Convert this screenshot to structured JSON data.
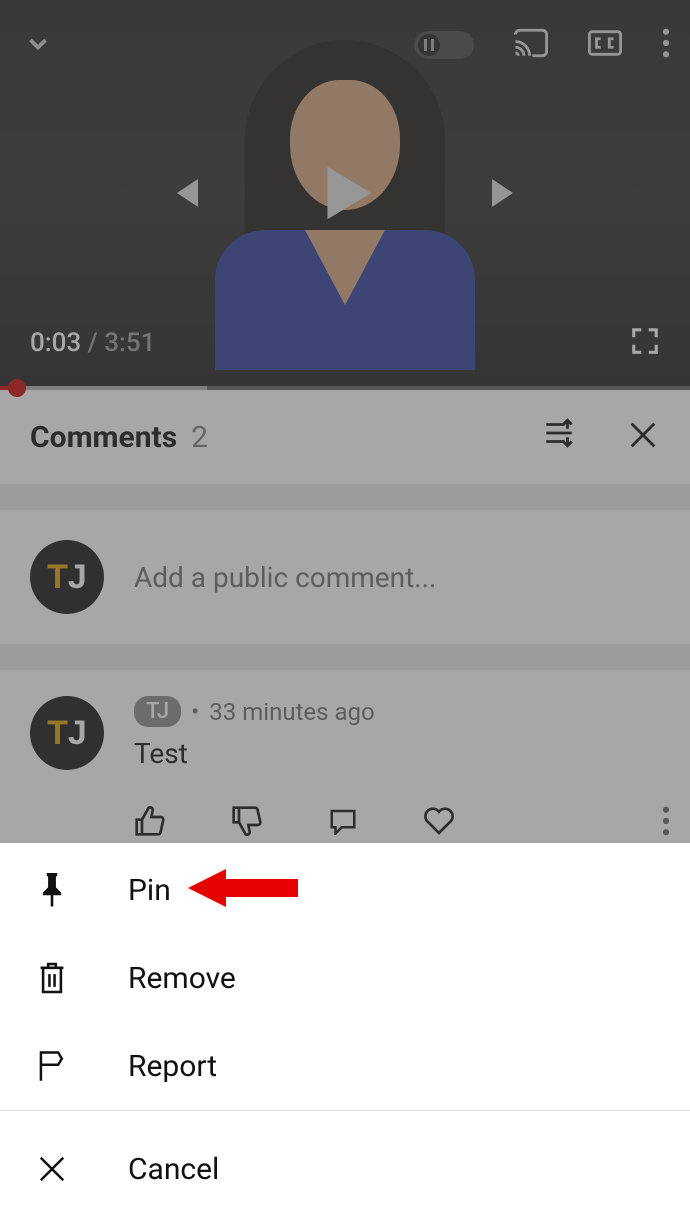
{
  "video": {
    "current_time": "0:03",
    "duration": "3:51"
  },
  "comments": {
    "title": "Comments",
    "count": "2",
    "add_placeholder": "Add a public comment...",
    "items": [
      {
        "author": "TJ",
        "timestamp": "33 minutes ago",
        "text": "Test"
      }
    ]
  },
  "sheet": {
    "pin": "Pin",
    "remove": "Remove",
    "report": "Report",
    "cancel": "Cancel"
  }
}
